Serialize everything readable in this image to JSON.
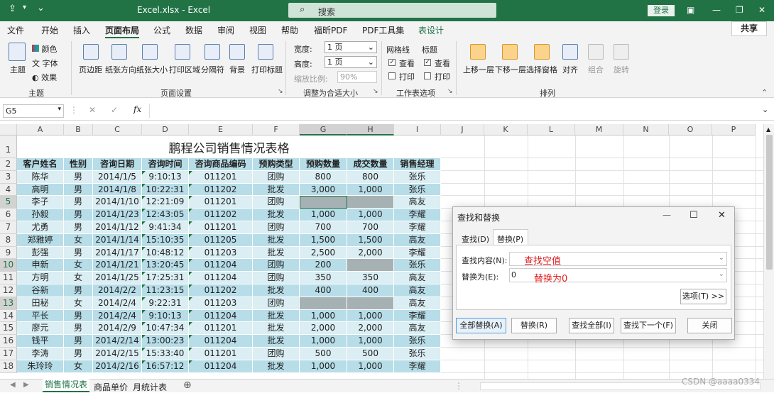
{
  "window": {
    "file_title": "Excel.xlsx  -  Excel",
    "search_placeholder": "搜索",
    "login": "登录",
    "share": "共享"
  },
  "menu": [
    "文件",
    "开始",
    "插入",
    "页面布局",
    "公式",
    "数据",
    "审阅",
    "视图",
    "帮助",
    "福昕PDF",
    "PDF工具集",
    "表设计"
  ],
  "ribbon": {
    "theme": {
      "main": "主题",
      "colors": "颜色",
      "fonts": "字体",
      "effects": "效果",
      "group": "主题"
    },
    "page_setup": {
      "buttons": [
        "页边距",
        "纸张方向",
        "纸张大小",
        "打印区域",
        "分隔符",
        "背景",
        "打印标题"
      ],
      "group": "页面设置"
    },
    "scale": {
      "width_label": "宽度:",
      "width_value": "1 页",
      "height_label": "高度:",
      "height_value": "1 页",
      "ratio_label": "缩放比例:",
      "ratio_value": "90%",
      "group": "调整为合适大小"
    },
    "sheet_options": {
      "gridlines": "网格线",
      "headings": "标题",
      "view": "查看",
      "print": "打印",
      "group": "工作表选项"
    },
    "arrange": {
      "buttons": [
        "上移一层",
        "下移一层",
        "选择窗格",
        "对齐",
        "组合",
        "旋转"
      ],
      "group": "排列"
    }
  },
  "formula_bar": {
    "name_box": "G5",
    "fx": "fx",
    "content": ""
  },
  "columns": [
    "A",
    "B",
    "C",
    "D",
    "E",
    "F",
    "G",
    "H",
    "I",
    "J",
    "K",
    "L",
    "M",
    "N",
    "O",
    "P"
  ],
  "table_title": "鹏程公司销售情况表格",
  "headers": [
    "客户姓名",
    "性别",
    "咨询日期",
    "咨询时间",
    "咨询商品编码",
    "预购类型",
    "预购数量",
    "成交数量",
    "销售经理"
  ],
  "rows": [
    {
      "num": "3",
      "cells": [
        "陈华",
        "男",
        "2014/1/5",
        "9:10:13",
        "011201",
        "团购",
        "800",
        "800",
        "张乐"
      ]
    },
    {
      "num": "4",
      "cells": [
        "高明",
        "男",
        "2014/1/8",
        "10:22:31",
        "011202",
        "批发",
        "3,000",
        "1,000",
        "张乐"
      ]
    },
    {
      "num": "5",
      "cells": [
        "李子",
        "男",
        "2014/1/10",
        "12:21:09",
        "011201",
        "团购",
        "",
        "",
        "高友"
      ]
    },
    {
      "num": "6",
      "cells": [
        "孙毅",
        "男",
        "2014/1/23",
        "12:43:05",
        "011202",
        "批发",
        "1,000",
        "1,000",
        "李耀"
      ]
    },
    {
      "num": "7",
      "cells": [
        "尤勇",
        "男",
        "2014/1/12",
        "9:41:34",
        "011201",
        "团购",
        "700",
        "700",
        "李耀"
      ]
    },
    {
      "num": "8",
      "cells": [
        "郑雅婷",
        "女",
        "2014/1/14",
        "15:10:35",
        "011205",
        "批发",
        "1,500",
        "1,500",
        "高友"
      ]
    },
    {
      "num": "9",
      "cells": [
        "彭强",
        "男",
        "2014/1/17",
        "10:48:12",
        "011203",
        "批发",
        "2,500",
        "2,000",
        "李耀"
      ]
    },
    {
      "num": "10",
      "cells": [
        "申新",
        "女",
        "2014/1/21",
        "13:20:45",
        "011204",
        "团购",
        "200",
        "",
        "张乐"
      ]
    },
    {
      "num": "11",
      "cells": [
        "方明",
        "女",
        "2014/1/25",
        "17:25:31",
        "011204",
        "团购",
        "350",
        "350",
        "高友"
      ]
    },
    {
      "num": "12",
      "cells": [
        "谷新",
        "男",
        "2014/2/2",
        "11:23:15",
        "011202",
        "批发",
        "400",
        "400",
        "高友"
      ]
    },
    {
      "num": "13",
      "cells": [
        "田秘",
        "女",
        "2014/2/4",
        "9:22:31",
        "011203",
        "团购",
        "",
        "",
        "高友"
      ]
    },
    {
      "num": "14",
      "cells": [
        "平长",
        "男",
        "2014/2/4",
        "9:10:13",
        "011204",
        "批发",
        "1,000",
        "1,000",
        "李耀"
      ]
    },
    {
      "num": "15",
      "cells": [
        "廖元",
        "男",
        "2014/2/9",
        "10:47:34",
        "011201",
        "批发",
        "2,000",
        "2,000",
        "高友"
      ]
    },
    {
      "num": "16",
      "cells": [
        "钱平",
        "男",
        "2014/2/14",
        "13:00:23",
        "011204",
        "批发",
        "1,000",
        "1,000",
        "张乐"
      ]
    },
    {
      "num": "17",
      "cells": [
        "李涛",
        "男",
        "2014/2/15",
        "15:33:40",
        "011201",
        "团购",
        "500",
        "500",
        "张乐"
      ]
    },
    {
      "num": "18",
      "cells": [
        "朱玲玲",
        "女",
        "2014/2/16",
        "16:57:12",
        "011204",
        "批发",
        "1,000",
        "1,000",
        "李耀"
      ]
    }
  ],
  "dialog": {
    "title": "查找和替换",
    "tab_find": "查找(D)",
    "tab_replace": "替换(P)",
    "find_label": "查找内容(N):",
    "find_value": "",
    "find_annotation": "查找空值",
    "replace_label": "替换为(E):",
    "replace_value": "0",
    "replace_annotation": "替换为0",
    "options_btn": "选项(T) >>",
    "btn_replace_all": "全部替换(A)",
    "btn_replace": "替换(R)",
    "btn_find_all": "查找全部(I)",
    "btn_find_next": "查找下一个(F)",
    "btn_close": "关闭"
  },
  "sheets": [
    "销售情况表",
    "商品单价",
    "月统计表"
  ],
  "watermark": "CSDN @aaaa0334",
  "colors": {
    "excel_green": "#217346",
    "band_dark": "#b7dde8",
    "band_light": "#daeef3",
    "gray_cell": "#a6b1b4",
    "annotation_red": "#e02020"
  }
}
